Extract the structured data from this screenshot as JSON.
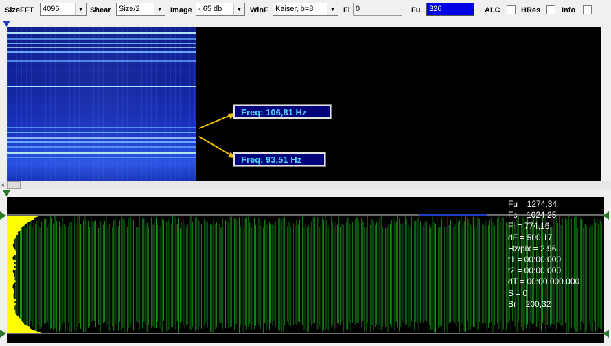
{
  "toolbar": {
    "sizefft": {
      "label": "SizeFFT",
      "value": "4096"
    },
    "shear": {
      "label": "Shear",
      "value": "Size/2"
    },
    "image": {
      "label": "Image",
      "value": "- 65 db"
    },
    "winf": {
      "label": "WinF",
      "value": "Kaiser, b=8"
    },
    "fl": {
      "label": "Fl",
      "value": "0"
    },
    "fu": {
      "label": "Fu",
      "value": "326"
    },
    "alc": {
      "label": "ALC",
      "checked": false
    },
    "hres": {
      "label": "HRes",
      "checked": false
    },
    "info": {
      "label": "Info",
      "checked": false
    }
  },
  "annotations": {
    "freq_upper": "Freq: 106,81 Hz",
    "freq_lower": "Freq: 93,51 Hz",
    "color": "#00007a",
    "text_color": "#4dd8ff",
    "arrow_color": "#f0c000"
  },
  "stats": [
    "Fu = 1274,34",
    "Fc = 1024,25",
    "Fl = 774,16",
    "dF = 500,17",
    "Hz/pix = 2,96",
    "t1 = 00:00.000",
    "t2 = 00:00.000",
    "dT = 00:00.000.000",
    "S = 0",
    "Br = 200,32"
  ],
  "colors": {
    "waveform": "#1ea81e",
    "envelope": "#ffff00",
    "marker": "#2a7a2a",
    "selection_marker": "#1e3cc8"
  }
}
